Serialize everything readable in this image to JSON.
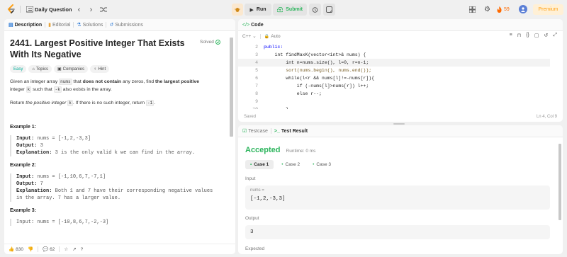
{
  "topbar": {
    "problem_list_label": "Daily Question",
    "run_label": "Run",
    "submit_label": "Submit",
    "streak_count": "59",
    "premium_label": "Premium"
  },
  "description_panel": {
    "tabs": [
      {
        "label": "Description"
      },
      {
        "label": "Editorial"
      },
      {
        "label": "Solutions"
      },
      {
        "label": "Submissions"
      }
    ],
    "title": "2441. Largest Positive Integer That Exists With Its Negative",
    "solved_label": "Solved",
    "chips": {
      "difficulty": "Easy",
      "topics": "Topics",
      "companies": "Companies",
      "hint": "Hint"
    },
    "para1": {
      "t1": "Given an integer array ",
      "c1": "nums",
      "t2": " that ",
      "b1": "does not contain",
      "t3": " any zeros, find ",
      "b2": "the largest positive",
      "t4": "integer ",
      "c2": "k",
      "t5": " such that ",
      "c3": "-k",
      "t6": " also exists in the array."
    },
    "para2": {
      "t1": "Return ",
      "i1": "the positive integer",
      "t2": " ",
      "c1": "k",
      "t3": ". If there is no such integer, return ",
      "c2": "-1",
      "t4": "."
    },
    "examples": [
      {
        "title": "Example 1:",
        "input_label": "Input:",
        "input_value": "nums = [-1,2,-3,3]",
        "output_label": "Output:",
        "output_value": "3",
        "explanation_label": "Explanation:",
        "explanation_value": "3 is the only valid k we can find in the array."
      },
      {
        "title": "Example 2:",
        "input_label": "Input:",
        "input_value": "nums = [-1,10,6,7,-7,1]",
        "output_label": "Output:",
        "output_value": "7",
        "explanation_label": "Explanation:",
        "explanation_value_1": "Both 1 and 7 have their corresponding negative values",
        "explanation_value_2": "in the array. 7 has a larger value."
      },
      {
        "title": "Example 3:",
        "input_partial": "Input: nums = [-10,8,6,7,-2,-3]"
      }
    ],
    "footer": {
      "likes": "830",
      "comments": "62"
    }
  },
  "code_panel": {
    "header_label": "Code",
    "language": "C++",
    "autocomplete": "Auto",
    "lines": [
      {
        "n": "2",
        "code": "public:"
      },
      {
        "n": "3",
        "code": "    int findMaxK(vector<int>& nums) {"
      },
      {
        "n": "4",
        "code": "        int n=nums.size(), l=0, r=n-1;"
      },
      {
        "n": "5",
        "code": "        sort(nums.begin(), nums.end());"
      },
      {
        "n": "6",
        "code": "        while(l<r && nums[l]!=-nums[r]){"
      },
      {
        "n": "7",
        "code": "            if (-nums[l]>nums[r]) l++;"
      },
      {
        "n": "8",
        "code": "            else r--;"
      },
      {
        "n": "9",
        "code": ""
      },
      {
        "n": "10",
        "code": "        }"
      }
    ],
    "saved_label": "Saved",
    "cursor_pos": "Ln 4, Col 9"
  },
  "result_panel": {
    "tab_testcase": "Testcase",
    "tab_result": "Test Result",
    "status": "Accepted",
    "runtime": "Runtime: 0 ms",
    "cases": [
      "Case 1",
      "Case 2",
      "Case 3"
    ],
    "input_label": "Input",
    "input_var": "nums =",
    "input_value": "[-1,2,-3,3]",
    "output_label": "Output",
    "output_value": "3",
    "expected_label": "Expected"
  },
  "colors": {
    "accent_green": "#2db55d",
    "easy_teal": "#00af9b",
    "premium_orange": "#ffa116",
    "streak_orange": "#ff6a00"
  }
}
